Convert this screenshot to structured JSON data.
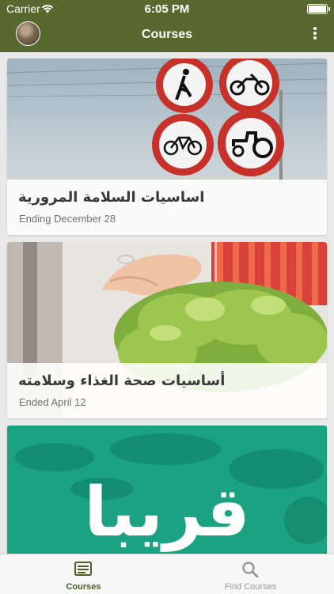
{
  "status_bar": {
    "carrier": "Carrier",
    "time": "6:05 PM",
    "wifi_icon": "wifi-icon",
    "battery_icon": "battery-icon"
  },
  "nav": {
    "title": "Courses",
    "avatar_icon": "avatar",
    "menu_icon": "more-vertical-icon"
  },
  "colors": {
    "brand": "#58692f",
    "active_tab": "#4e5e28",
    "inactive_tab": "#9a9a9a"
  },
  "courses": [
    {
      "title": "اساسيات السلامة المرورية",
      "status": "Ending December 28"
    },
    {
      "title": "أساسيات صحة الغذاء وسلامته",
      "status": "Ended April 12"
    },
    {
      "title": "قريبا",
      "status": ""
    }
  ],
  "tabs": [
    {
      "label": "Courses",
      "icon": "courses-list-icon",
      "active": true
    },
    {
      "label": "Find Courses",
      "icon": "search-icon",
      "active": false
    }
  ]
}
